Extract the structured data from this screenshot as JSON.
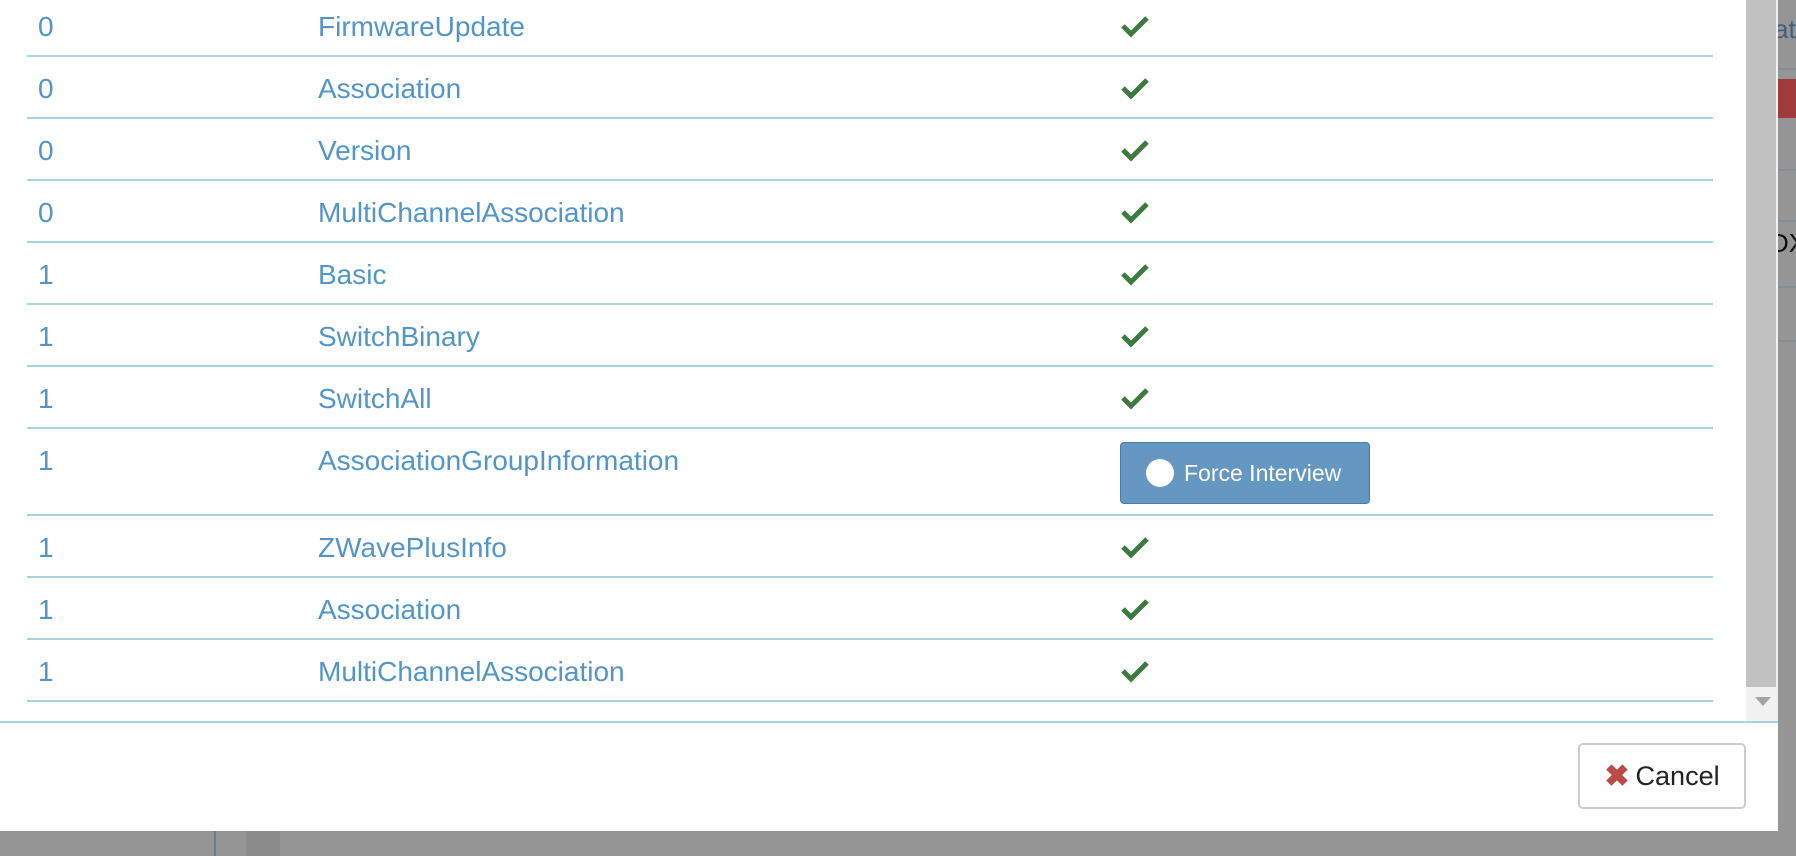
{
  "rows": [
    {
      "instance": "0",
      "command_class": "FirmwareUpdate",
      "status": "done"
    },
    {
      "instance": "0",
      "command_class": "Association",
      "status": "done"
    },
    {
      "instance": "0",
      "command_class": "Version",
      "status": "done"
    },
    {
      "instance": "0",
      "command_class": "MultiChannelAssociation",
      "status": "done"
    },
    {
      "instance": "1",
      "command_class": "Basic",
      "status": "done"
    },
    {
      "instance": "1",
      "command_class": "SwitchBinary",
      "status": "done"
    },
    {
      "instance": "1",
      "command_class": "SwitchAll",
      "status": "done"
    },
    {
      "instance": "1",
      "command_class": "AssociationGroupInformation",
      "status": "pending",
      "action_label": "Force Interview"
    },
    {
      "instance": "1",
      "command_class": "ZWavePlusInfo",
      "status": "done"
    },
    {
      "instance": "1",
      "command_class": "Association",
      "status": "done"
    },
    {
      "instance": "1",
      "command_class": "MultiChannelAssociation",
      "status": "done"
    }
  ],
  "footer": {
    "cancel_label": "Cancel"
  },
  "background": {
    "partial_link": "at",
    "partial_text": "DX"
  },
  "colors": {
    "link": "#5295c9",
    "check": "#3d7a40",
    "button": "#6497c1",
    "cancel_icon": "#b94a48",
    "divider": "#a9d3e3"
  },
  "icons": {
    "done": "check-icon",
    "force": "circle-icon",
    "cancel": "x-icon"
  }
}
